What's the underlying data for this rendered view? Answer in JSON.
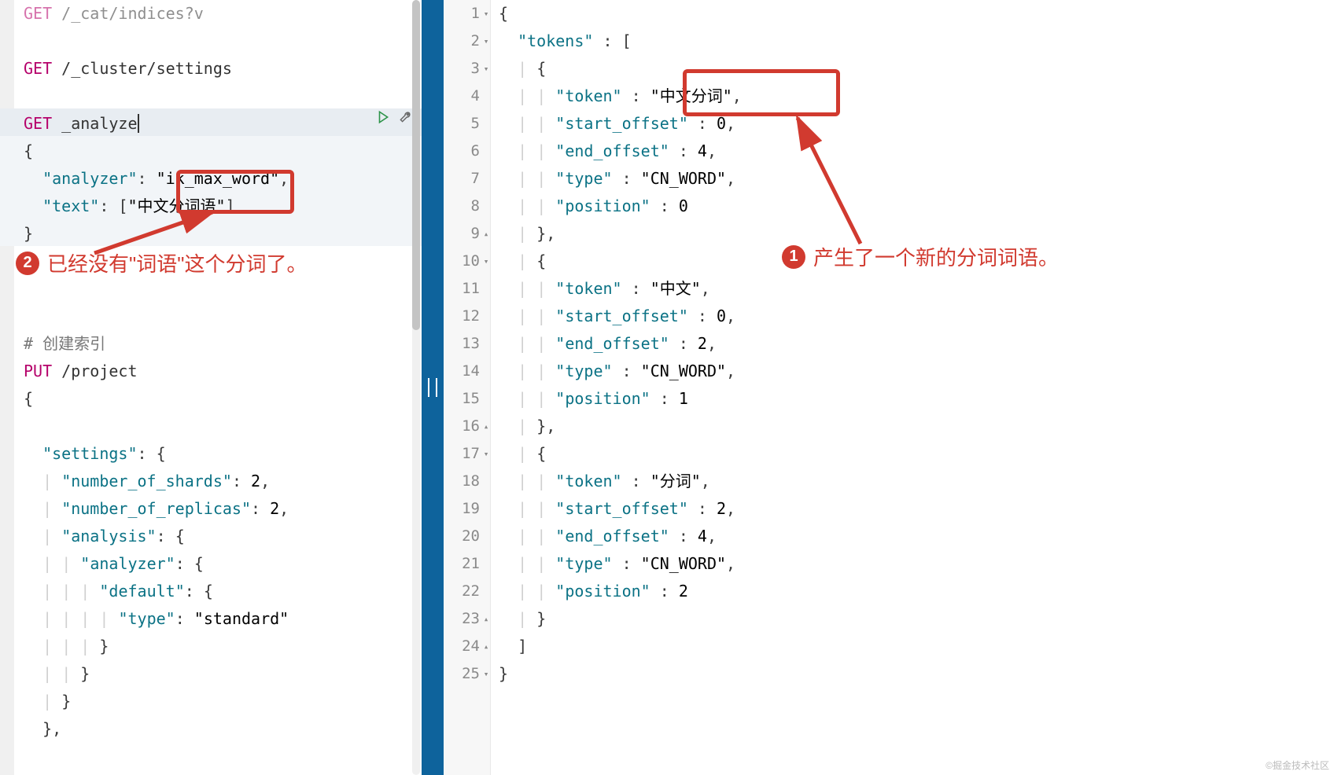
{
  "left": {
    "lines": [
      {
        "type": "req",
        "method": "GET",
        "path": "/_cat/indices?v",
        "faded": true
      },
      {
        "type": "blank"
      },
      {
        "type": "req",
        "method": "GET",
        "path": "/_cluster/settings"
      },
      {
        "type": "blank"
      },
      {
        "type": "req",
        "method": "GET",
        "path": "_analyze",
        "cursor": true,
        "hl": "line",
        "actions": true
      },
      {
        "type": "code",
        "text": "{",
        "hl": "block",
        "fold": true
      },
      {
        "type": "code",
        "text": "  \"analyzer\": \"ik_max_word\",",
        "hl": "block"
      },
      {
        "type": "code",
        "text": "  \"text\": [\"中文分词语\"]",
        "hl": "block"
      },
      {
        "type": "code",
        "text": "}",
        "hl": "block"
      },
      {
        "type": "blank"
      },
      {
        "type": "blank"
      },
      {
        "type": "blank"
      },
      {
        "type": "comment",
        "text": "# 创建索引"
      },
      {
        "type": "put",
        "method": "PUT",
        "path": "/project"
      },
      {
        "type": "code",
        "text": "{",
        "fold": true
      },
      {
        "type": "code",
        "text": "",
        "fold": false
      },
      {
        "type": "code",
        "text": "  \"settings\": {",
        "fold": true
      },
      {
        "type": "code",
        "text": "  | \"number_of_shards\": 2,"
      },
      {
        "type": "code",
        "text": "  | \"number_of_replicas\": 2,"
      },
      {
        "type": "code",
        "text": "  | \"analysis\": {",
        "fold": true
      },
      {
        "type": "code",
        "text": "  | | \"analyzer\": {",
        "fold": true
      },
      {
        "type": "code",
        "text": "  | | | \"default\": {",
        "fold": true
      },
      {
        "type": "code",
        "text": "  | | | | \"type\": \"standard\""
      },
      {
        "type": "code",
        "text": "  | | | }"
      },
      {
        "type": "code",
        "text": "  | | }"
      },
      {
        "type": "code",
        "text": "  | }"
      },
      {
        "type": "code",
        "text": "  },"
      }
    ]
  },
  "right": {
    "line_numbers": [
      "1",
      "2",
      "3",
      "4",
      "5",
      "6",
      "7",
      "8",
      "9",
      "10",
      "11",
      "12",
      "13",
      "14",
      "15",
      "16",
      "17",
      "18",
      "19",
      "20",
      "21",
      "22",
      "23",
      "24",
      "25"
    ],
    "folds": [
      "▾",
      "▾",
      "▾",
      "",
      "",
      "",
      "",
      "",
      "▴",
      "▾",
      "",
      "",
      "",
      "",
      "",
      "▴",
      "▾",
      "",
      "",
      "",
      "",
      "",
      "▴",
      "▴",
      "▾"
    ],
    "lines": [
      "{",
      "  \"tokens\" : [",
      "  | {",
      "  | | \"token\" : \"中文分词\",",
      "  | | \"start_offset\" : 0,",
      "  | | \"end_offset\" : 4,",
      "  | | \"type\" : \"CN_WORD\",",
      "  | | \"position\" : 0",
      "  | },",
      "  | {",
      "  | | \"token\" : \"中文\",",
      "  | | \"start_offset\" : 0,",
      "  | | \"end_offset\" : 2,",
      "  | | \"type\" : \"CN_WORD\",",
      "  | | \"position\" : 1",
      "  | },",
      "  | {",
      "  | | \"token\" : \"分词\",",
      "  | | \"start_offset\" : 2,",
      "  | | \"end_offset\" : 4,",
      "  | | \"type\" : \"CN_WORD\",",
      "  | | \"position\" : 2",
      "  | }",
      "  ]",
      "}"
    ]
  },
  "annotations": {
    "a1_text": "产生了一个新的分词词语。",
    "a2_text": "已经没有\"词语\"这个分词了。"
  },
  "watermark": "©掘金技术社区"
}
